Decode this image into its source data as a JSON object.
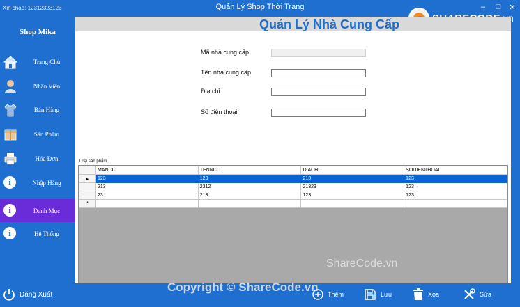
{
  "titlebar": {
    "greeting": "Xin chào: 12312323123",
    "title": "Quản Lý Shop Thời Trang",
    "logo_brand": "SHARECODE",
    "logo_ext": ".vn"
  },
  "sidebar": {
    "shop_name": "Shop Mika",
    "items": [
      {
        "label": "Trang Chủ",
        "icon": "house-icon"
      },
      {
        "label": "Nhân Viên",
        "icon": "person-icon"
      },
      {
        "label": "Bán Hàng",
        "icon": "shirt-icon"
      },
      {
        "label": "Sản Phẩm",
        "icon": "package-icon"
      },
      {
        "label": "Hóa Đơn",
        "icon": "printer-icon"
      },
      {
        "label": "Nhập Hàng",
        "icon": "info-icon"
      },
      {
        "label": "Danh Mục",
        "icon": "info-icon"
      },
      {
        "label": "Hệ Thống",
        "icon": "info-icon"
      }
    ],
    "logout_label": "Đăng Xuất"
  },
  "main": {
    "page_title": "Quản Lý Nhà Cung Cấp",
    "form": {
      "id_label": "Mã nhà cung cấp",
      "id_value": "",
      "name_label": "Tên nhà cung cấp",
      "name_value": "",
      "address_label": "Địa chỉ",
      "address_value": "",
      "phone_label": "Số điện thoại",
      "phone_value": ""
    },
    "grid": {
      "group_label": "Loại sản phẩm",
      "columns": [
        "MANCC",
        "TENNCC",
        "DIACHI",
        "SODIENTHOAI"
      ],
      "rows": [
        [
          "123",
          "123",
          "213",
          "123"
        ],
        [
          "213",
          "2312",
          "21323",
          "123"
        ],
        [
          "23",
          "213",
          "123",
          "123"
        ]
      ],
      "selected_row": 0,
      "current_row_marker": "▸",
      "new_row_marker": "*"
    }
  },
  "toolbar": {
    "add_label": "Thêm",
    "save_label": "Lưu",
    "delete_label": "Xóa",
    "edit_label": "Sửa"
  },
  "overlay": {
    "copyright": "Copyright © ShareCode.vn",
    "watermark": "ShareCode.vn"
  },
  "colors": {
    "accent": "#1e6fd0",
    "active_nav": "#6a2bd8",
    "selection": "#0a63d6"
  }
}
